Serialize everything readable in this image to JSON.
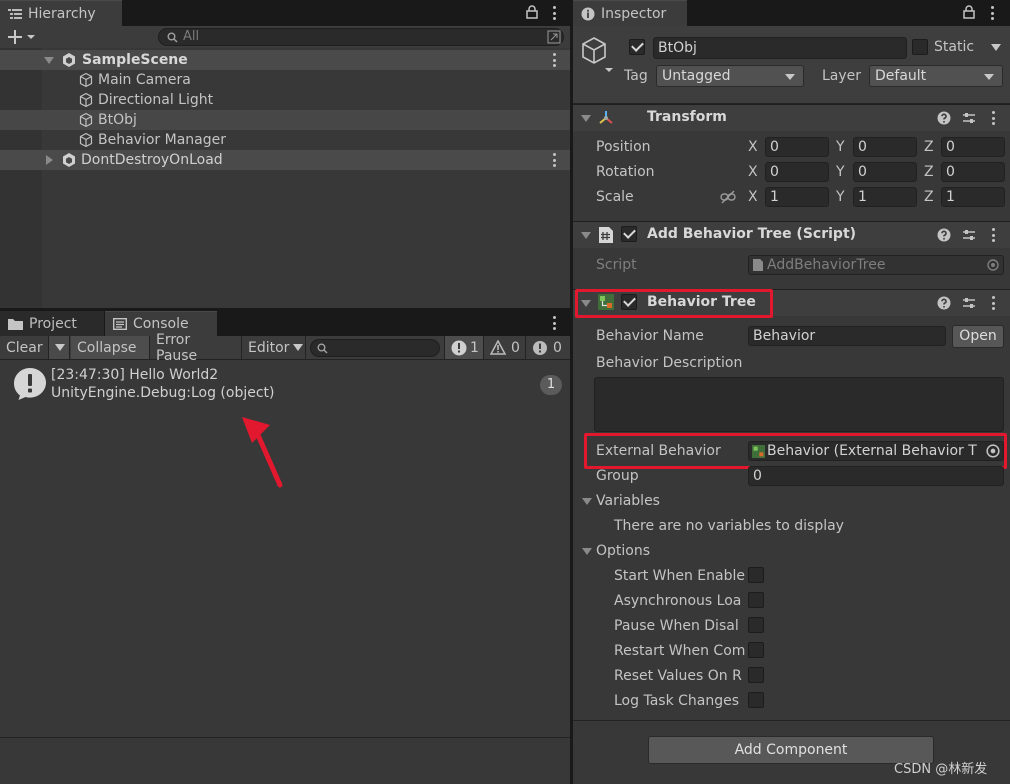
{
  "hierarchy": {
    "tab": "Hierarchy",
    "search_placeholder": "All",
    "scene": "SampleScene",
    "items": [
      "Main Camera",
      "Directional Light",
      "BtObj",
      "Behavior Manager"
    ],
    "ddol": "DontDestroyOnLoad"
  },
  "bottom": {
    "tabs": [
      "Project",
      "Console"
    ],
    "toolbar": {
      "clear": "Clear",
      "collapse": "Collapse",
      "error_pause": "Error Pause",
      "editor": "Editor"
    },
    "counts": {
      "info": "1",
      "warn": "0",
      "error": "0"
    }
  },
  "console": {
    "entry_line1": "[23:47:30] Hello World2",
    "entry_line2": "UnityEngine.Debug:Log (object)",
    "entry_count": "1"
  },
  "inspector": {
    "tab": "Inspector",
    "object_name": "BtObj",
    "static_label": "Static",
    "tag_label": "Tag",
    "tag_value": "Untagged",
    "layer_label": "Layer",
    "layer_value": "Default",
    "transform": {
      "title": "Transform",
      "position_label": "Position",
      "rotation_label": "Rotation",
      "scale_label": "Scale",
      "axes": [
        "X",
        "Y",
        "Z"
      ],
      "position": [
        "0",
        "0",
        "0"
      ],
      "rotation": [
        "0",
        "0",
        "0"
      ],
      "scale": [
        "1",
        "1",
        "1"
      ]
    },
    "script_component": {
      "title": "Add Behavior Tree (Script)",
      "script_label": "Script",
      "script_value": "AddBehaviorTree"
    },
    "behavior_tree": {
      "title": "Behavior Tree",
      "name_label": "Behavior Name",
      "name_value": "Behavior",
      "open_button": "Open",
      "description_label": "Behavior Description",
      "external_label": "External Behavior",
      "external_value": "Behavior (External Behavior T",
      "group_label": "Group",
      "group_value": "0",
      "variables_label": "Variables",
      "no_variables": "There are no variables to display",
      "options_label": "Options",
      "options": [
        "Start When Enable",
        "Asynchronous Loa",
        "Pause When Disal",
        "Restart When Com",
        "Reset Values On R",
        "Log Task Changes"
      ]
    },
    "add_component": "Add Component"
  },
  "watermark": "CSDN @林新发",
  "colors": {
    "highlight": "#e2182f",
    "background": "#383838"
  }
}
